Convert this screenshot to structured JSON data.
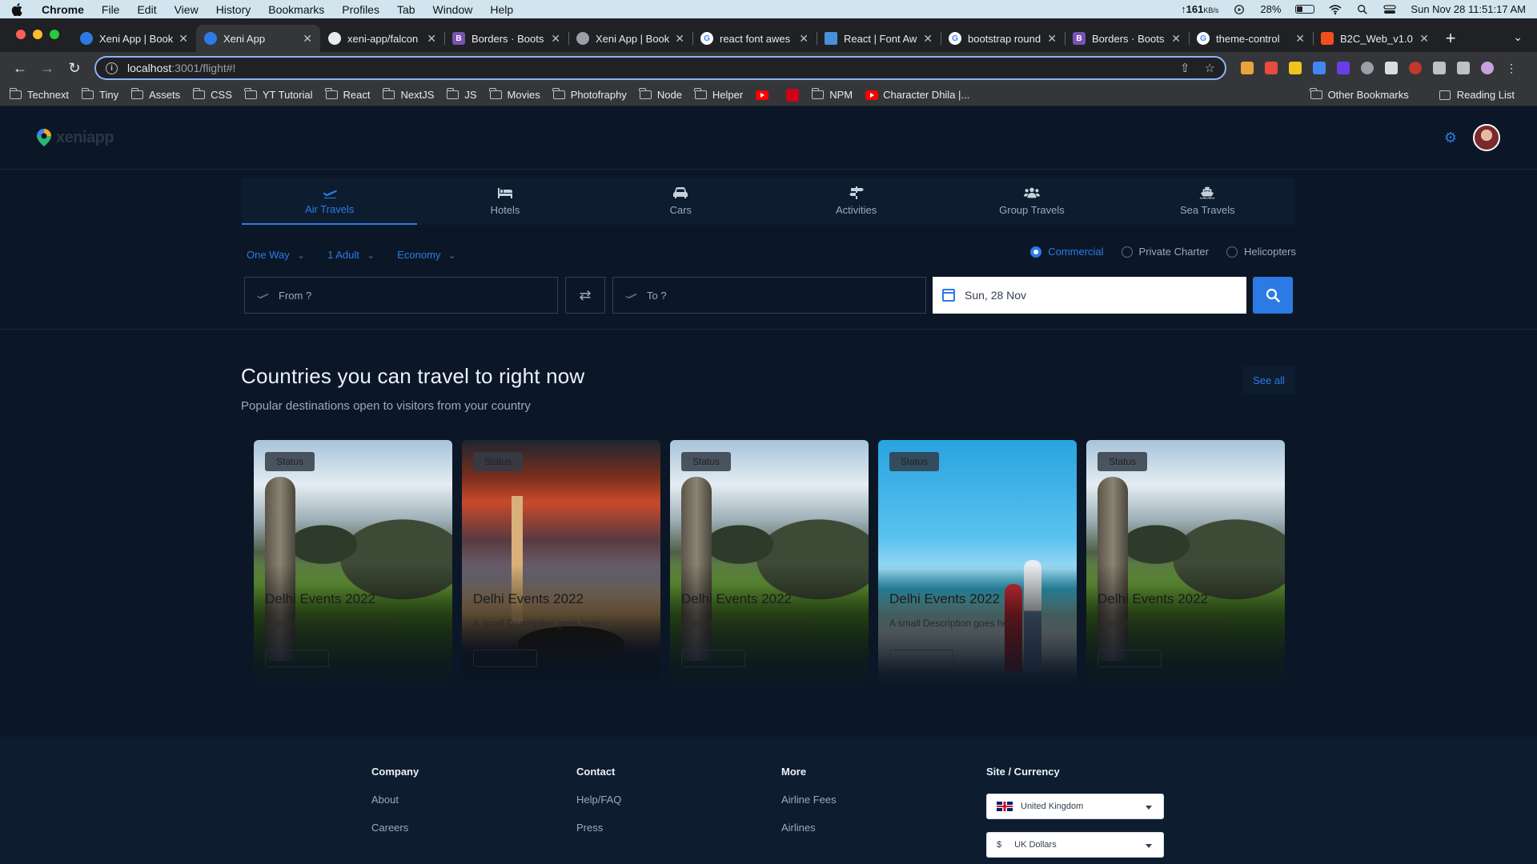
{
  "menubar": {
    "app_name": "Chrome",
    "items": [
      "File",
      "Edit",
      "View",
      "History",
      "Bookmarks",
      "Profiles",
      "Tab",
      "Window",
      "Help"
    ],
    "net_speed": "161",
    "net_unit": "KB/s",
    "battery": "28%",
    "datetime": "Sun Nov 28  11:51:17 AM"
  },
  "tabs": [
    {
      "title": "Xeni App | Book",
      "color": "#2c7be5",
      "glyph": ""
    },
    {
      "title": "Xeni App",
      "color": "#2c7be5",
      "glyph": "",
      "active": true
    },
    {
      "title": "xeni-app/falcon",
      "color": "#e8eaed",
      "glyph": ""
    },
    {
      "title": "Borders · Boots",
      "color": "#7952b3",
      "glyph": "B"
    },
    {
      "title": "Xeni App | Book",
      "color": "#9aa0a6",
      "glyph": ""
    },
    {
      "title": "react font awes",
      "color": "#ffffff",
      "glyph": "G"
    },
    {
      "title": "React | Font Aw",
      "color": "#4a90d9",
      "glyph": ""
    },
    {
      "title": "bootstrap round",
      "color": "#ffffff",
      "glyph": "G"
    },
    {
      "title": "Borders · Boots",
      "color": "#7952b3",
      "glyph": "B"
    },
    {
      "title": "theme-control",
      "color": "#ffffff",
      "glyph": "G"
    },
    {
      "title": "B2C_Web_v1.0",
      "color": "#f24e1e",
      "glyph": ""
    }
  ],
  "address": {
    "host": "localhost",
    "path": ":3001/flight#!"
  },
  "bookmarks": {
    "items": [
      {
        "label": "Technext",
        "type": "folder"
      },
      {
        "label": "Tiny",
        "type": "folder"
      },
      {
        "label": "Assets",
        "type": "folder"
      },
      {
        "label": "CSS",
        "type": "folder"
      },
      {
        "label": "YT Tutorial",
        "type": "folder"
      },
      {
        "label": "React",
        "type": "folder"
      },
      {
        "label": "NextJS",
        "type": "folder"
      },
      {
        "label": "JS",
        "type": "folder"
      },
      {
        "label": "Movies",
        "type": "folder"
      },
      {
        "label": "Photofraphy",
        "type": "folder"
      },
      {
        "label": "Node",
        "type": "folder"
      },
      {
        "label": "Helper",
        "type": "folder"
      }
    ],
    "npm": "NPM",
    "character": "Character Dhila |...",
    "other": "Other Bookmarks",
    "reading": "Reading List"
  },
  "app": {
    "logo": "xeniapp",
    "modes": [
      {
        "label": "Air Travels",
        "icon": "plane-icon"
      },
      {
        "label": "Hotels",
        "icon": "bed-icon"
      },
      {
        "label": "Cars",
        "icon": "car-icon"
      },
      {
        "label": "Activities",
        "icon": "signpost-icon"
      },
      {
        "label": "Group Travels",
        "icon": "users-icon"
      },
      {
        "label": "Sea Travels",
        "icon": "ship-icon"
      }
    ],
    "trip_type": "One Way",
    "passengers": "1 Adult",
    "cabin": "Economy",
    "flight_types": [
      "Commercial",
      "Private Charter",
      "Helicopters"
    ],
    "from_placeholder": "From ?",
    "to_placeholder": "To ?",
    "date": "Sun, 28 Nov",
    "section_title": "Countries you can travel to right now",
    "section_sub": "Popular destinations open to visitors from your country",
    "see_all": "See all",
    "cards": [
      {
        "status": "Status",
        "title": "Delhi Events 2022",
        "desc": "A small Description goes here",
        "image": "statue"
      },
      {
        "status": "Status",
        "title": "Delhi Events 2022",
        "desc": "A small Description goes here",
        "image": "bridge"
      },
      {
        "status": "Status",
        "title": "Delhi Events 2022",
        "desc": "A small Description goes here",
        "image": "statue"
      },
      {
        "status": "Status",
        "title": "Delhi Events 2022",
        "desc": "A small Description goes here",
        "image": "beach"
      },
      {
        "status": "Status",
        "title": "Delhi Events 2022",
        "desc": "A small Description goes here",
        "image": "statue"
      }
    ]
  },
  "footer": {
    "company": {
      "title": "Company",
      "links": [
        "About",
        "Careers"
      ]
    },
    "contact": {
      "title": "Contact",
      "links": [
        "Help/FAQ",
        "Press"
      ]
    },
    "more": {
      "title": "More",
      "links": [
        "Airline Fees",
        "Airlines"
      ]
    },
    "site": {
      "title": "Site / Currency",
      "country": "United Kingdom",
      "currency_symbol": "$",
      "currency": "UK Dollars"
    }
  },
  "colors": {
    "primary": "#2c7be5",
    "background": "#0b1727",
    "panel": "#0e1c2f"
  }
}
